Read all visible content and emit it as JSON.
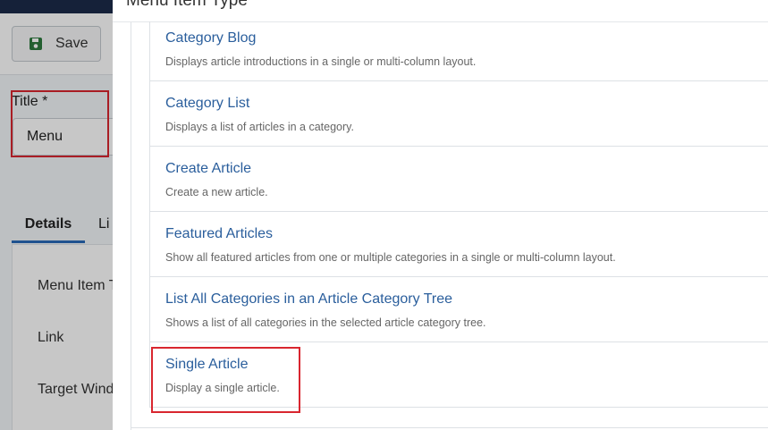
{
  "toolbar": {
    "save_label": "Save"
  },
  "form": {
    "title_label": "Title *",
    "title_value": "Menu",
    "tabs": [
      "Details",
      "Li"
    ],
    "fields": [
      "Menu Item T",
      "Link",
      "Target Wind"
    ]
  },
  "modal": {
    "title": "Menu Item Type",
    "items": [
      {
        "title": "Category Blog",
        "desc": "Displays article introductions in a single or multi-column layout."
      },
      {
        "title": "Category List",
        "desc": "Displays a list of articles in a category."
      },
      {
        "title": "Create Article",
        "desc": "Create a new article."
      },
      {
        "title": "Featured Articles",
        "desc": "Show all featured articles from one or multiple categories in a single or multi-column layout."
      },
      {
        "title": "List All Categories in an Article Category Tree",
        "desc": "Shows a list of all categories in the selected article category tree."
      },
      {
        "title": "Single Article",
        "desc": "Display a single article."
      }
    ]
  },
  "colors": {
    "accent": "#2a5e9c",
    "highlight": "#d9262f",
    "topbar": "#1c2b4a"
  }
}
